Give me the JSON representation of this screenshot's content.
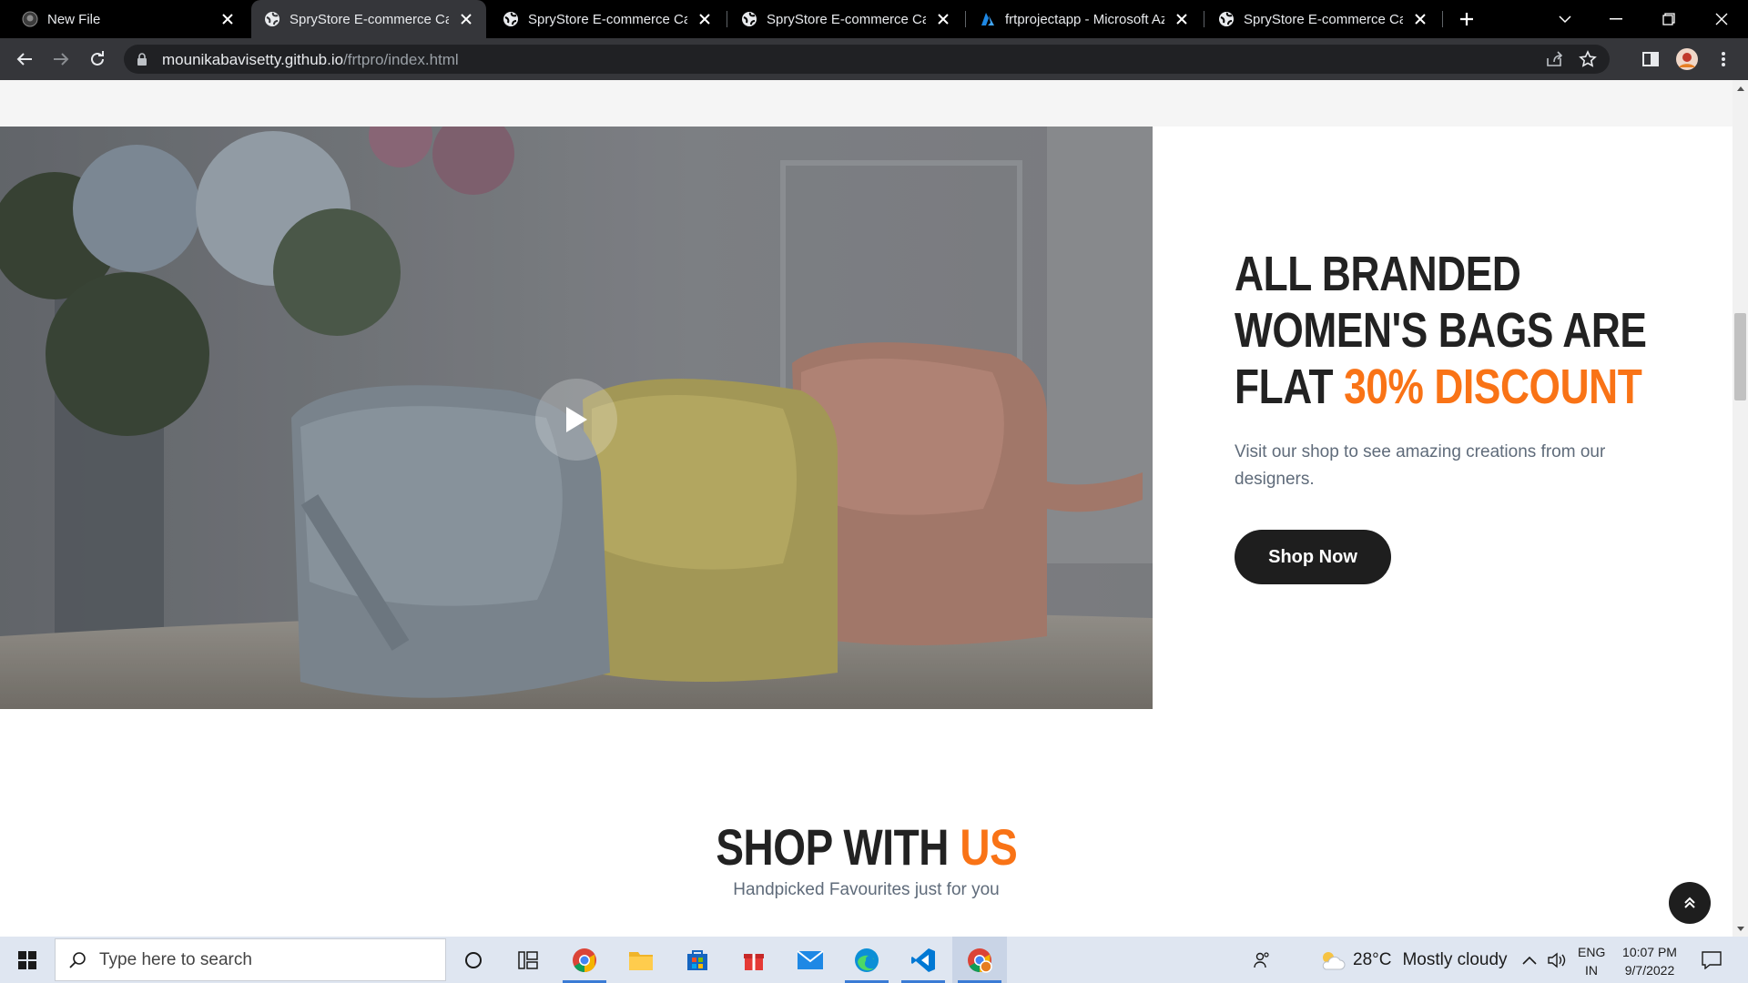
{
  "browser": {
    "tabs": [
      {
        "title": "New File",
        "favicon": "github-icon",
        "active": false
      },
      {
        "title": "SpryStore E-commerce Catalog",
        "favicon": "globe-icon",
        "active": true
      },
      {
        "title": "SpryStore E-commerce Catalog",
        "favicon": "globe-icon",
        "active": false
      },
      {
        "title": "SpryStore E-commerce Catalog",
        "favicon": "globe-icon",
        "active": false
      },
      {
        "title": "frtprojectapp - Microsoft Azure",
        "favicon": "azure-icon",
        "active": false
      },
      {
        "title": "SpryStore E-commerce Catalog",
        "favicon": "globe-icon",
        "active": false
      }
    ],
    "url_host": "mounikabavisetty.github.io",
    "url_path": "/frtpro/index.html"
  },
  "hero": {
    "title_line1": "ALL BRANDED",
    "title_line2": "WOMEN'S BAGS ARE",
    "title_line3_plain": "FLAT ",
    "title_line3_accent": "30% DISCOUNT",
    "description": "Visit our shop to see amazing creations from our designers.",
    "cta_label": "Shop Now"
  },
  "shop_section": {
    "title_plain": "SHOP WITH ",
    "title_accent": "US",
    "subtitle": "Handpicked Favourites just for you"
  },
  "taskbar": {
    "search_placeholder": "Type here to search",
    "weather_temp": "28°C",
    "weather_desc": "Mostly cloudy",
    "lang_line1": "ENG",
    "lang_line2": "IN",
    "time": "10:07 PM",
    "date": "9/7/2022"
  },
  "colors": {
    "accent": "#f97316",
    "dark": "#1e1e1e",
    "chrome_bg": "#35363a"
  }
}
